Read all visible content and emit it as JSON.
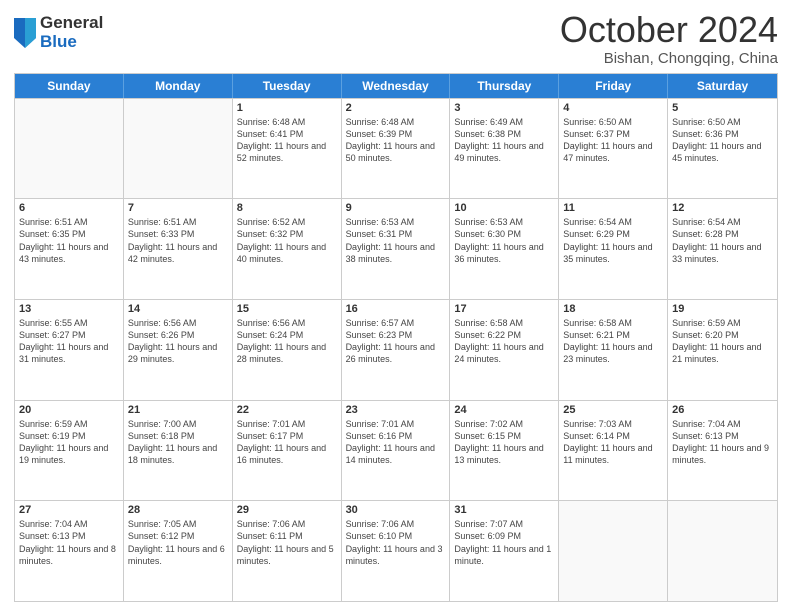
{
  "logo": {
    "general": "General",
    "blue": "Blue"
  },
  "title": "October 2024",
  "subtitle": "Bishan, Chongqing, China",
  "weekdays": [
    "Sunday",
    "Monday",
    "Tuesday",
    "Wednesday",
    "Thursday",
    "Friday",
    "Saturday"
  ],
  "weeks": [
    [
      {
        "date": "",
        "info": ""
      },
      {
        "date": "",
        "info": ""
      },
      {
        "date": "1",
        "info": "Sunrise: 6:48 AM\nSunset: 6:41 PM\nDaylight: 11 hours and 52 minutes."
      },
      {
        "date": "2",
        "info": "Sunrise: 6:48 AM\nSunset: 6:39 PM\nDaylight: 11 hours and 50 minutes."
      },
      {
        "date": "3",
        "info": "Sunrise: 6:49 AM\nSunset: 6:38 PM\nDaylight: 11 hours and 49 minutes."
      },
      {
        "date": "4",
        "info": "Sunrise: 6:50 AM\nSunset: 6:37 PM\nDaylight: 11 hours and 47 minutes."
      },
      {
        "date": "5",
        "info": "Sunrise: 6:50 AM\nSunset: 6:36 PM\nDaylight: 11 hours and 45 minutes."
      }
    ],
    [
      {
        "date": "6",
        "info": "Sunrise: 6:51 AM\nSunset: 6:35 PM\nDaylight: 11 hours and 43 minutes."
      },
      {
        "date": "7",
        "info": "Sunrise: 6:51 AM\nSunset: 6:33 PM\nDaylight: 11 hours and 42 minutes."
      },
      {
        "date": "8",
        "info": "Sunrise: 6:52 AM\nSunset: 6:32 PM\nDaylight: 11 hours and 40 minutes."
      },
      {
        "date": "9",
        "info": "Sunrise: 6:53 AM\nSunset: 6:31 PM\nDaylight: 11 hours and 38 minutes."
      },
      {
        "date": "10",
        "info": "Sunrise: 6:53 AM\nSunset: 6:30 PM\nDaylight: 11 hours and 36 minutes."
      },
      {
        "date": "11",
        "info": "Sunrise: 6:54 AM\nSunset: 6:29 PM\nDaylight: 11 hours and 35 minutes."
      },
      {
        "date": "12",
        "info": "Sunrise: 6:54 AM\nSunset: 6:28 PM\nDaylight: 11 hours and 33 minutes."
      }
    ],
    [
      {
        "date": "13",
        "info": "Sunrise: 6:55 AM\nSunset: 6:27 PM\nDaylight: 11 hours and 31 minutes."
      },
      {
        "date": "14",
        "info": "Sunrise: 6:56 AM\nSunset: 6:26 PM\nDaylight: 11 hours and 29 minutes."
      },
      {
        "date": "15",
        "info": "Sunrise: 6:56 AM\nSunset: 6:24 PM\nDaylight: 11 hours and 28 minutes."
      },
      {
        "date": "16",
        "info": "Sunrise: 6:57 AM\nSunset: 6:23 PM\nDaylight: 11 hours and 26 minutes."
      },
      {
        "date": "17",
        "info": "Sunrise: 6:58 AM\nSunset: 6:22 PM\nDaylight: 11 hours and 24 minutes."
      },
      {
        "date": "18",
        "info": "Sunrise: 6:58 AM\nSunset: 6:21 PM\nDaylight: 11 hours and 23 minutes."
      },
      {
        "date": "19",
        "info": "Sunrise: 6:59 AM\nSunset: 6:20 PM\nDaylight: 11 hours and 21 minutes."
      }
    ],
    [
      {
        "date": "20",
        "info": "Sunrise: 6:59 AM\nSunset: 6:19 PM\nDaylight: 11 hours and 19 minutes."
      },
      {
        "date": "21",
        "info": "Sunrise: 7:00 AM\nSunset: 6:18 PM\nDaylight: 11 hours and 18 minutes."
      },
      {
        "date": "22",
        "info": "Sunrise: 7:01 AM\nSunset: 6:17 PM\nDaylight: 11 hours and 16 minutes."
      },
      {
        "date": "23",
        "info": "Sunrise: 7:01 AM\nSunset: 6:16 PM\nDaylight: 11 hours and 14 minutes."
      },
      {
        "date": "24",
        "info": "Sunrise: 7:02 AM\nSunset: 6:15 PM\nDaylight: 11 hours and 13 minutes."
      },
      {
        "date": "25",
        "info": "Sunrise: 7:03 AM\nSunset: 6:14 PM\nDaylight: 11 hours and 11 minutes."
      },
      {
        "date": "26",
        "info": "Sunrise: 7:04 AM\nSunset: 6:13 PM\nDaylight: 11 hours and 9 minutes."
      }
    ],
    [
      {
        "date": "27",
        "info": "Sunrise: 7:04 AM\nSunset: 6:13 PM\nDaylight: 11 hours and 8 minutes."
      },
      {
        "date": "28",
        "info": "Sunrise: 7:05 AM\nSunset: 6:12 PM\nDaylight: 11 hours and 6 minutes."
      },
      {
        "date": "29",
        "info": "Sunrise: 7:06 AM\nSunset: 6:11 PM\nDaylight: 11 hours and 5 minutes."
      },
      {
        "date": "30",
        "info": "Sunrise: 7:06 AM\nSunset: 6:10 PM\nDaylight: 11 hours and 3 minutes."
      },
      {
        "date": "31",
        "info": "Sunrise: 7:07 AM\nSunset: 6:09 PM\nDaylight: 11 hours and 1 minute."
      },
      {
        "date": "",
        "info": ""
      },
      {
        "date": "",
        "info": ""
      }
    ]
  ]
}
